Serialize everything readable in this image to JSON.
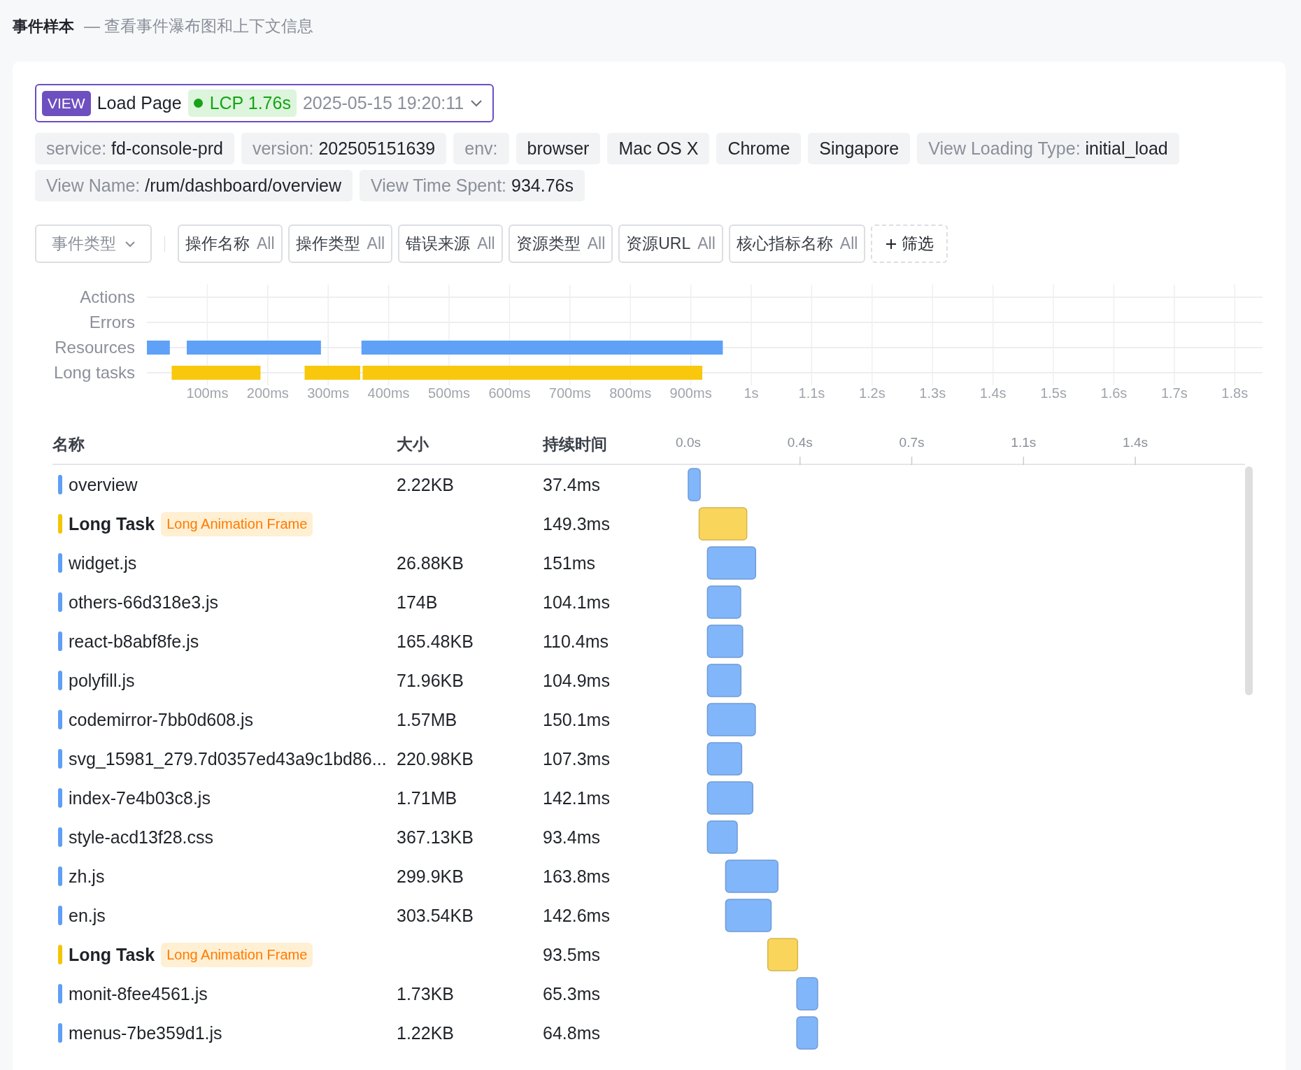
{
  "header": {
    "title": "事件样本",
    "subtitle": "— 查看事件瀑布图和上下文信息"
  },
  "view_selector": {
    "badge": "VIEW",
    "name": "Load Page",
    "metric": "LCP 1.76s",
    "time": "2025-05-15 19:20:11"
  },
  "tags": [
    {
      "key": "service:",
      "value": "fd-console-prd"
    },
    {
      "key": "version:",
      "value": "202505151639"
    },
    {
      "key": "env:"
    },
    {
      "value": "browser"
    },
    {
      "value": "Mac OS X"
    },
    {
      "value": "Chrome"
    },
    {
      "value": "Singapore"
    },
    {
      "key": "View Loading Type:",
      "value": "initial_load"
    },
    {
      "key": "View Name:",
      "value": "/rum/dashboard/overview"
    },
    {
      "key": "View Time Spent:",
      "value": "934.76s"
    }
  ],
  "filters": {
    "event_type": {
      "placeholder": "事件类型"
    },
    "facets": [
      {
        "label": "操作名称",
        "value": "All"
      },
      {
        "label": "操作类型",
        "value": "All"
      },
      {
        "label": "错误来源",
        "value": "All"
      },
      {
        "label": "资源类型",
        "value": "All"
      },
      {
        "label": "资源URL",
        "value": "All"
      },
      {
        "label": "核心指标名称",
        "value": "All"
      }
    ],
    "add_button": "筛选"
  },
  "timeline": {
    "rows": [
      "Actions",
      "Errors",
      "Resources",
      "Long tasks"
    ],
    "ticks": [
      "100ms",
      "200ms",
      "300ms",
      "400ms",
      "500ms",
      "600ms",
      "700ms",
      "800ms",
      "900ms",
      "1s",
      "1.1s",
      "1.2s",
      "1.3s",
      "1.4s",
      "1.5s",
      "1.6s",
      "1.7s",
      "1.8s"
    ]
  },
  "table": {
    "columns": [
      "名称",
      "大小",
      "持续时间"
    ],
    "rows": [
      {
        "kind": "resource",
        "name": "overview",
        "size": "2.22KB",
        "duration": "37.4ms"
      },
      {
        "kind": "long_task",
        "name": "Long Task",
        "badge": "Long Animation Frame",
        "duration": "149.3ms"
      },
      {
        "kind": "resource",
        "name": "widget.js",
        "size": "26.88KB",
        "duration": "151ms"
      },
      {
        "kind": "resource",
        "name": "others-66d318e3.js",
        "size": "174B",
        "duration": "104.1ms"
      },
      {
        "kind": "resource",
        "name": "react-b8abf8fe.js",
        "size": "165.48KB",
        "duration": "110.4ms"
      },
      {
        "kind": "resource",
        "name": "polyfill.js",
        "size": "71.96KB",
        "duration": "104.9ms"
      },
      {
        "kind": "resource",
        "name": "codemirror-7bb0d608.js",
        "size": "1.57MB",
        "duration": "150.1ms"
      },
      {
        "kind": "resource",
        "name": "svg_15981_279.7d0357ed43a9c1bd86...",
        "size": "220.98KB",
        "duration": "107.3ms"
      },
      {
        "kind": "resource",
        "name": "index-7e4b03c8.js",
        "size": "1.71MB",
        "duration": "142.1ms"
      },
      {
        "kind": "resource",
        "name": "style-acd13f28.css",
        "size": "367.13KB",
        "duration": "93.4ms"
      },
      {
        "kind": "resource",
        "name": "zh.js",
        "size": "299.9KB",
        "duration": "163.8ms"
      },
      {
        "kind": "resource",
        "name": "en.js",
        "size": "303.54KB",
        "duration": "142.6ms"
      },
      {
        "kind": "long_task",
        "name": "Long Task",
        "badge": "Long Animation Frame",
        "duration": "93.5ms"
      },
      {
        "kind": "resource",
        "name": "monit-8fee4561.js",
        "size": "1.73KB",
        "duration": "65.3ms"
      },
      {
        "kind": "resource",
        "name": "menus-7be359d1.js",
        "size": "1.22KB",
        "duration": "64.8ms"
      }
    ],
    "waterfall_ticks": [
      "0.0s",
      "0.4s",
      "0.7s",
      "1.1s",
      "1.4s"
    ]
  }
}
